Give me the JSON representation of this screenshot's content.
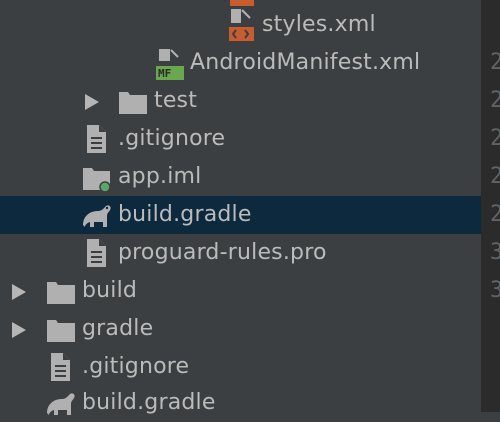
{
  "project_tree": {
    "rows": [
      {
        "label": "styles.xml",
        "icon": "xml-resource-file-icon"
      },
      {
        "label": "AndroidManifest.xml",
        "icon": "manifest-file-icon"
      },
      {
        "label": "test",
        "icon": "folder-icon"
      },
      {
        "label": ".gitignore",
        "icon": "text-file-icon"
      },
      {
        "label": "app.iml",
        "icon": "module-file-icon"
      },
      {
        "label": "build.gradle",
        "icon": "gradle-file-icon"
      },
      {
        "label": "proguard-rules.pro",
        "icon": "text-file-icon"
      },
      {
        "label": "build",
        "icon": "folder-icon"
      },
      {
        "label": "gradle",
        "icon": "folder-icon"
      },
      {
        "label": ".gitignore",
        "icon": "text-file-icon"
      },
      {
        "label": "build.gradle",
        "icon": "gradle-file-icon"
      }
    ],
    "selected_label": "build.gradle"
  },
  "editor_gutter": {
    "line_numbers": [
      "2",
      "2",
      "2",
      "2",
      "2",
      "3",
      "3"
    ]
  }
}
